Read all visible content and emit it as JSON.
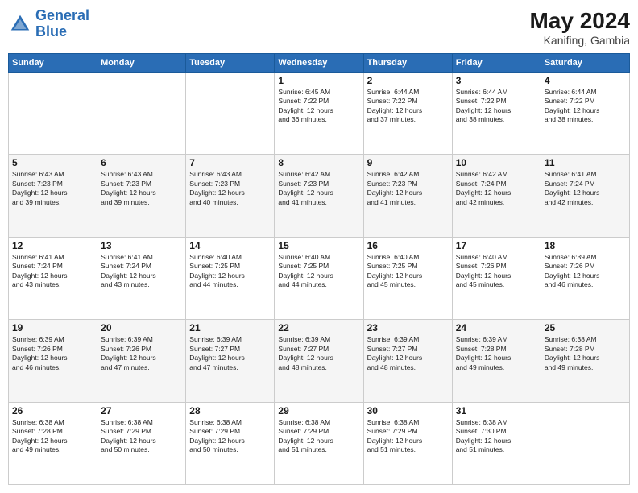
{
  "header": {
    "logo_line1": "General",
    "logo_line2": "Blue",
    "month_year": "May 2024",
    "location": "Kanifing, Gambia"
  },
  "weekdays": [
    "Sunday",
    "Monday",
    "Tuesday",
    "Wednesday",
    "Thursday",
    "Friday",
    "Saturday"
  ],
  "weeks": [
    [
      {
        "day": "",
        "info": ""
      },
      {
        "day": "",
        "info": ""
      },
      {
        "day": "",
        "info": ""
      },
      {
        "day": "1",
        "info": "Sunrise: 6:45 AM\nSunset: 7:22 PM\nDaylight: 12 hours\nand 36 minutes."
      },
      {
        "day": "2",
        "info": "Sunrise: 6:44 AM\nSunset: 7:22 PM\nDaylight: 12 hours\nand 37 minutes."
      },
      {
        "day": "3",
        "info": "Sunrise: 6:44 AM\nSunset: 7:22 PM\nDaylight: 12 hours\nand 38 minutes."
      },
      {
        "day": "4",
        "info": "Sunrise: 6:44 AM\nSunset: 7:22 PM\nDaylight: 12 hours\nand 38 minutes."
      }
    ],
    [
      {
        "day": "5",
        "info": "Sunrise: 6:43 AM\nSunset: 7:23 PM\nDaylight: 12 hours\nand 39 minutes."
      },
      {
        "day": "6",
        "info": "Sunrise: 6:43 AM\nSunset: 7:23 PM\nDaylight: 12 hours\nand 39 minutes."
      },
      {
        "day": "7",
        "info": "Sunrise: 6:43 AM\nSunset: 7:23 PM\nDaylight: 12 hours\nand 40 minutes."
      },
      {
        "day": "8",
        "info": "Sunrise: 6:42 AM\nSunset: 7:23 PM\nDaylight: 12 hours\nand 41 minutes."
      },
      {
        "day": "9",
        "info": "Sunrise: 6:42 AM\nSunset: 7:23 PM\nDaylight: 12 hours\nand 41 minutes."
      },
      {
        "day": "10",
        "info": "Sunrise: 6:42 AM\nSunset: 7:24 PM\nDaylight: 12 hours\nand 42 minutes."
      },
      {
        "day": "11",
        "info": "Sunrise: 6:41 AM\nSunset: 7:24 PM\nDaylight: 12 hours\nand 42 minutes."
      }
    ],
    [
      {
        "day": "12",
        "info": "Sunrise: 6:41 AM\nSunset: 7:24 PM\nDaylight: 12 hours\nand 43 minutes."
      },
      {
        "day": "13",
        "info": "Sunrise: 6:41 AM\nSunset: 7:24 PM\nDaylight: 12 hours\nand 43 minutes."
      },
      {
        "day": "14",
        "info": "Sunrise: 6:40 AM\nSunset: 7:25 PM\nDaylight: 12 hours\nand 44 minutes."
      },
      {
        "day": "15",
        "info": "Sunrise: 6:40 AM\nSunset: 7:25 PM\nDaylight: 12 hours\nand 44 minutes."
      },
      {
        "day": "16",
        "info": "Sunrise: 6:40 AM\nSunset: 7:25 PM\nDaylight: 12 hours\nand 45 minutes."
      },
      {
        "day": "17",
        "info": "Sunrise: 6:40 AM\nSunset: 7:26 PM\nDaylight: 12 hours\nand 45 minutes."
      },
      {
        "day": "18",
        "info": "Sunrise: 6:39 AM\nSunset: 7:26 PM\nDaylight: 12 hours\nand 46 minutes."
      }
    ],
    [
      {
        "day": "19",
        "info": "Sunrise: 6:39 AM\nSunset: 7:26 PM\nDaylight: 12 hours\nand 46 minutes."
      },
      {
        "day": "20",
        "info": "Sunrise: 6:39 AM\nSunset: 7:26 PM\nDaylight: 12 hours\nand 47 minutes."
      },
      {
        "day": "21",
        "info": "Sunrise: 6:39 AM\nSunset: 7:27 PM\nDaylight: 12 hours\nand 47 minutes."
      },
      {
        "day": "22",
        "info": "Sunrise: 6:39 AM\nSunset: 7:27 PM\nDaylight: 12 hours\nand 48 minutes."
      },
      {
        "day": "23",
        "info": "Sunrise: 6:39 AM\nSunset: 7:27 PM\nDaylight: 12 hours\nand 48 minutes."
      },
      {
        "day": "24",
        "info": "Sunrise: 6:39 AM\nSunset: 7:28 PM\nDaylight: 12 hours\nand 49 minutes."
      },
      {
        "day": "25",
        "info": "Sunrise: 6:38 AM\nSunset: 7:28 PM\nDaylight: 12 hours\nand 49 minutes."
      }
    ],
    [
      {
        "day": "26",
        "info": "Sunrise: 6:38 AM\nSunset: 7:28 PM\nDaylight: 12 hours\nand 49 minutes."
      },
      {
        "day": "27",
        "info": "Sunrise: 6:38 AM\nSunset: 7:29 PM\nDaylight: 12 hours\nand 50 minutes."
      },
      {
        "day": "28",
        "info": "Sunrise: 6:38 AM\nSunset: 7:29 PM\nDaylight: 12 hours\nand 50 minutes."
      },
      {
        "day": "29",
        "info": "Sunrise: 6:38 AM\nSunset: 7:29 PM\nDaylight: 12 hours\nand 51 minutes."
      },
      {
        "day": "30",
        "info": "Sunrise: 6:38 AM\nSunset: 7:29 PM\nDaylight: 12 hours\nand 51 minutes."
      },
      {
        "day": "31",
        "info": "Sunrise: 6:38 AM\nSunset: 7:30 PM\nDaylight: 12 hours\nand 51 minutes."
      },
      {
        "day": "",
        "info": ""
      }
    ]
  ]
}
